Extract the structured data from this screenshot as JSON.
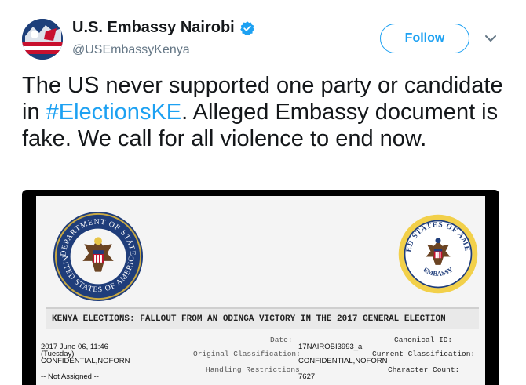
{
  "tweet": {
    "display_name": "U.S. Embassy Nairobi",
    "handle": "@USEmbassyKenya",
    "follow_label": "Follow",
    "text_before": "The US never supported one party or candidate in ",
    "hashtag": "#ElectionsKE",
    "text_after": ". Alleged Embassy document is fake. We call for all violence to end now."
  },
  "icons": {
    "avatar": "embassy-flag-avatar",
    "verified": "verified-badge-icon",
    "caret": "chevron-down-icon"
  },
  "colors": {
    "accent": "#1da1f2",
    "text": "#14171a",
    "secondary_text": "#657786"
  },
  "document": {
    "left_seal_text": "DEPARTMENT OF STATE • UNITED STATES OF AMERICA",
    "right_seal_text": "UNITED STATES OF AMERICA",
    "right_seal_bottom": "EMBASSY",
    "subject": "KENYA ELECTIONS: FALLOUT FROM AN ODINGA VICTORY IN THE 2017 GENERAL ELECTION",
    "date_label": "Date:",
    "canonical_label": "Canonical ID:",
    "date_value": "2017 June 06, 11:46",
    "day_value": "(Tuesday)",
    "canonical_value": "17NAIROBI3993_a",
    "orig_class_label": "Original Classification:",
    "curr_class_label": "Current Classification:",
    "orig_class_value": "CONFIDENTIAL,NOFORN",
    "curr_class_value": "CONFIDENTIAL,NOFORN",
    "handling_label": "Handling Restrictions",
    "char_count_label": "Character Count:",
    "handling_value": "-- Not Assigned --",
    "char_count_value": "7627"
  }
}
